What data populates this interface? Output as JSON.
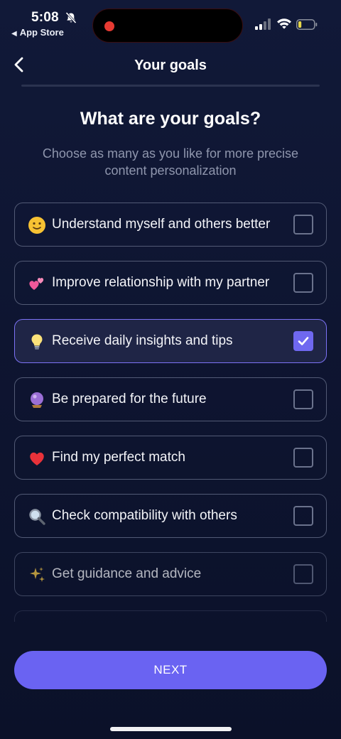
{
  "status_bar": {
    "time": "5:08",
    "back_app_label": "App Store",
    "icons": [
      "bell-slash-icon",
      "recording-dot-icon",
      "cellular-signal-icon",
      "wifi-icon",
      "battery-icon"
    ],
    "battery_level_fraction": 0.2,
    "battery_color": "#e6d64a"
  },
  "header": {
    "title": "Your goals",
    "back_icon": "chevron-left-icon"
  },
  "page": {
    "title": "What are your goals?",
    "subtitle": "Choose as many as you like for more precise content personalization"
  },
  "goals": [
    {
      "emoji": "slightly-smiling-face-icon",
      "label": "Understand myself and others better",
      "checked": false
    },
    {
      "emoji": "two-hearts-icon",
      "label": "Improve relationship with my partner",
      "checked": false
    },
    {
      "emoji": "light-bulb-icon",
      "label": "Receive daily insights and tips",
      "checked": true
    },
    {
      "emoji": "crystal-ball-icon",
      "label": "Be prepared for the future",
      "checked": false
    },
    {
      "emoji": "red-heart-icon",
      "label": "Find my perfect match",
      "checked": false
    },
    {
      "emoji": "magnifying-glass-icon",
      "label": "Check compatibility with others",
      "checked": false
    },
    {
      "emoji": "sparkles-icon",
      "label": "Get guidance and advice",
      "checked": false
    }
  ],
  "next_button": {
    "label": "NEXT"
  },
  "colors": {
    "background": "#0f1633",
    "accent": "#6a63f2",
    "selected_border": "#7c72f5",
    "card_border": "#525a75",
    "subtitle": "#8f96ad"
  }
}
